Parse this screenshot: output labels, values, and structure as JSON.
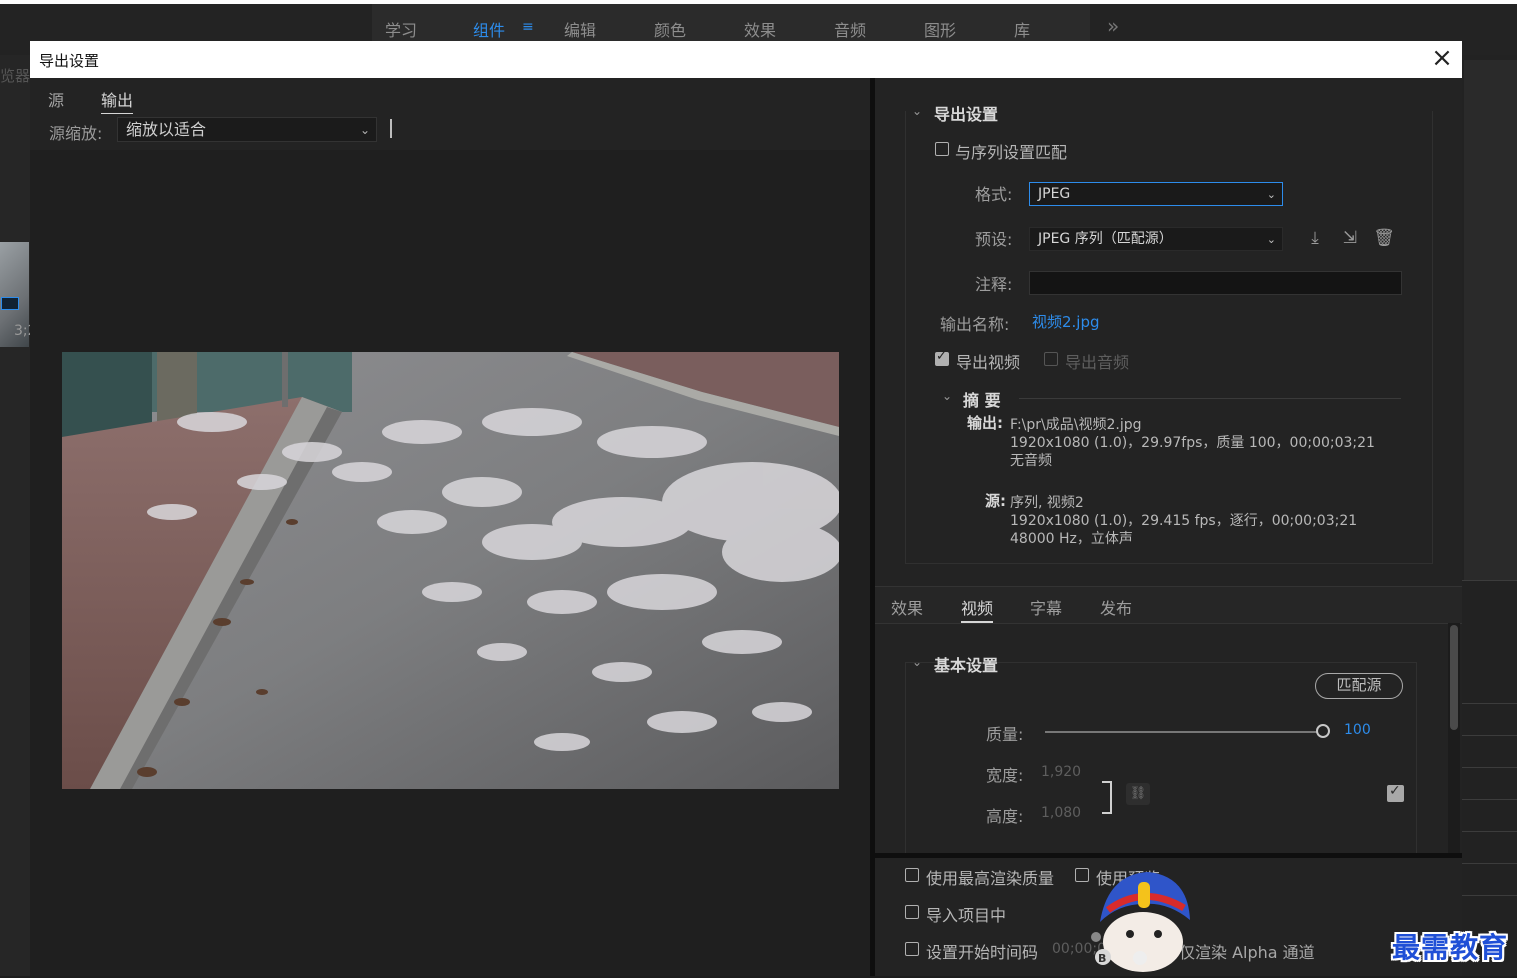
{
  "workspace": {
    "tabs": [
      "学习",
      "组件",
      "编辑",
      "颜色",
      "效果",
      "音频",
      "图形",
      "库"
    ],
    "active_tab": "组件",
    "accent_color": "#2d8ceb"
  },
  "background_left": {
    "panel_label": "览器",
    "timecode": "3;2"
  },
  "dialog": {
    "title": "导出设置",
    "close_icon": "close-icon",
    "left_tabs": [
      "源",
      "输出"
    ],
    "active_left_tab": "输出",
    "source_scale_label": "源缩放:",
    "source_scale_value": "缩放以适合"
  },
  "export_settings": {
    "section_title": "导出设置",
    "match_sequence_label": "与序列设置匹配",
    "match_sequence_checked": false,
    "format_label": "格式:",
    "format_value": "JPEG",
    "preset_label": "预设:",
    "preset_value": "JPEG 序列（匹配源）",
    "preset_icons": [
      "save-preset-icon",
      "import-preset-icon",
      "delete-preset-icon"
    ],
    "comment_label": "注释:",
    "comment_value": "",
    "output_name_label": "输出名称:",
    "output_name_value": "视频2.jpg",
    "export_video_label": "导出视频",
    "export_video_checked": true,
    "export_audio_label": "导出音频",
    "export_audio_checked": false
  },
  "summary": {
    "title": "摘 要",
    "output_key": "输出:",
    "output_lines": [
      "F:\\pr\\成品\\视频2.jpg",
      "1920x1080 (1.0)，29.97fps，质量 100，00;00;03;21",
      "无音频"
    ],
    "source_key": "源:",
    "source_lines": [
      "序列, 视频2",
      "1920x1080 (1.0)，29.415 fps，逐行，00;00;03;21",
      "48000 Hz，立体声"
    ]
  },
  "settings_tabs": [
    "效果",
    "视频",
    "字幕",
    "发布"
  ],
  "active_settings_tab": "视频",
  "basic_settings": {
    "title": "基本设置",
    "match_source_button": "匹配源",
    "quality_label": "质量:",
    "quality_value": "100",
    "quality_fraction": 1.0,
    "width_label": "宽度:",
    "width_value": "1,920",
    "height_label": "高度:",
    "height_value": "1,080"
  },
  "bottom_options": {
    "max_quality_label": "使用最高渲染质量",
    "use_preview_label": "使用预览",
    "import_project_label": "导入项目中",
    "set_start_tc_label": "设置开始时间码",
    "start_tc_value": "00;00;00;00",
    "alpha_only_label": "仅渲染 Alpha 通道"
  },
  "watermark": {
    "text": "最需教育"
  }
}
